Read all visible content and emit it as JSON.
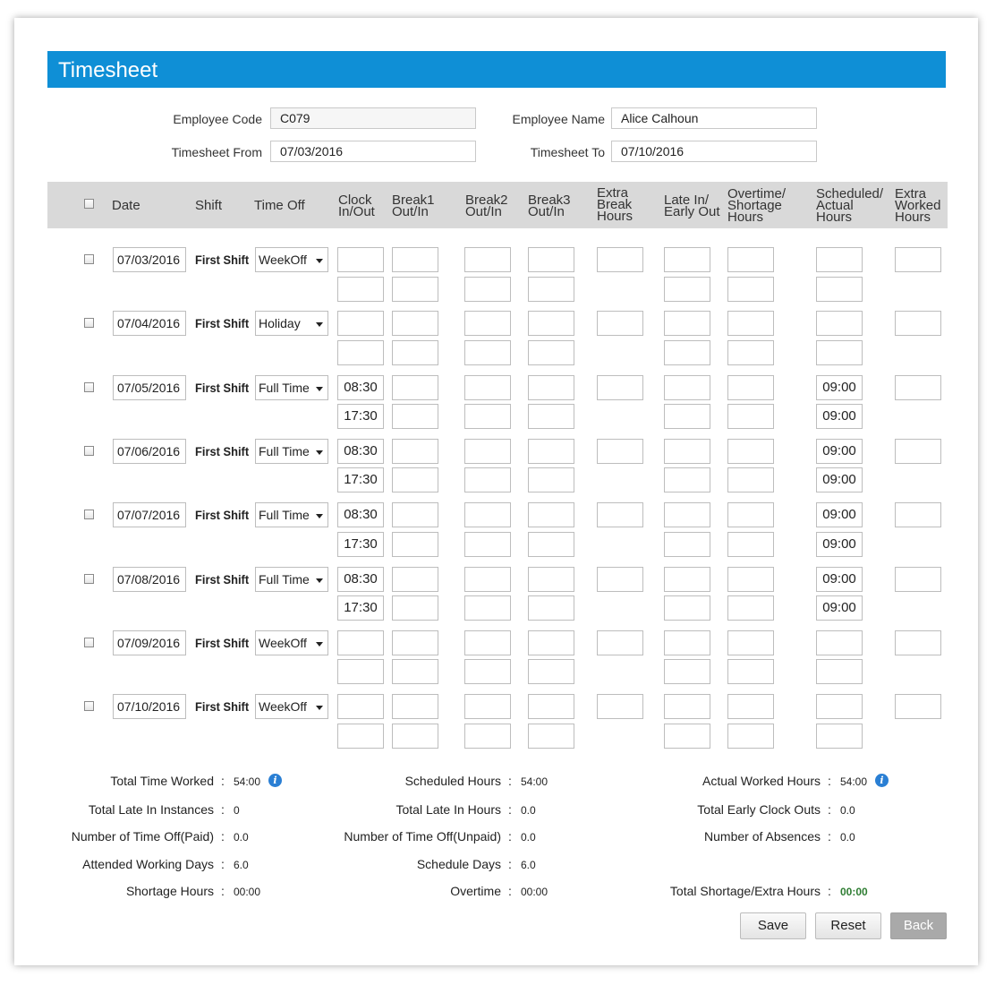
{
  "title": "Timesheet",
  "form": {
    "employee_code_label": "Employee Code",
    "employee_code": "C079",
    "employee_name_label": "Employee Name",
    "employee_name": "Alice Calhoun",
    "from_label": "Timesheet From",
    "from": "07/03/2016",
    "to_label": "Timesheet To",
    "to": "07/10/2016"
  },
  "headers": {
    "date": "Date",
    "shift": "Shift",
    "time_off": "Time Off",
    "clock": [
      "Clock",
      "In/Out"
    ],
    "break1": [
      "Break1",
      "Out/In"
    ],
    "break2": [
      "Break2",
      "Out/In"
    ],
    "break3": [
      "Break3",
      "Out/In"
    ],
    "extra_break": [
      "Extra",
      "Break",
      "Hours"
    ],
    "late": [
      "Late In/",
      "Early Out"
    ],
    "overtime": [
      "Overtime/",
      "Shortage",
      "Hours"
    ],
    "scheduled": [
      "Scheduled/",
      "Actual",
      "Hours"
    ],
    "extra_worked": [
      "Extra",
      "Worked",
      "Hours"
    ]
  },
  "rows": [
    {
      "date": "07/03/2016",
      "shift": "First Shift",
      "time_off": "WeekOff",
      "clock_in": "",
      "clock_out": "",
      "scheduled": "",
      "actual": ""
    },
    {
      "date": "07/04/2016",
      "shift": "First Shift",
      "time_off": "Holiday",
      "clock_in": "",
      "clock_out": "",
      "scheduled": "",
      "actual": ""
    },
    {
      "date": "07/05/2016",
      "shift": "First Shift",
      "time_off": "Full Time",
      "clock_in": "08:30",
      "clock_out": "17:30",
      "scheduled": "09:00",
      "actual": "09:00"
    },
    {
      "date": "07/06/2016",
      "shift": "First Shift",
      "time_off": "Full Time",
      "clock_in": "08:30",
      "clock_out": "17:30",
      "scheduled": "09:00",
      "actual": "09:00"
    },
    {
      "date": "07/07/2016",
      "shift": "First Shift",
      "time_off": "Full Time",
      "clock_in": "08:30",
      "clock_out": "17:30",
      "scheduled": "09:00",
      "actual": "09:00"
    },
    {
      "date": "07/08/2016",
      "shift": "First Shift",
      "time_off": "Full Time",
      "clock_in": "08:30",
      "clock_out": "17:30",
      "scheduled": "09:00",
      "actual": "09:00"
    },
    {
      "date": "07/09/2016",
      "shift": "First Shift",
      "time_off": "WeekOff",
      "clock_in": "",
      "clock_out": "",
      "scheduled": "",
      "actual": ""
    },
    {
      "date": "07/10/2016",
      "shift": "First Shift",
      "time_off": "WeekOff",
      "clock_in": "",
      "clock_out": "",
      "scheduled": "",
      "actual": ""
    }
  ],
  "summary": [
    [
      {
        "label": "Total Time Worked",
        "value": "54:00",
        "info": true
      },
      {
        "label": "Scheduled Hours",
        "value": "54:00"
      },
      {
        "label": "Actual Worked Hours",
        "value": "54:00",
        "info": true
      }
    ],
    [
      {
        "label": "Total Late In Instances",
        "value": "0"
      },
      {
        "label": "Total Late In Hours",
        "value": "0.0"
      },
      {
        "label": "Total Early Clock Outs",
        "value": "0.0"
      }
    ],
    [
      {
        "label": "Number of Time Off(Paid)",
        "value": "0.0"
      },
      {
        "label": "Number of Time Off(Unpaid)",
        "value": "0.0"
      },
      {
        "label": "Number of Absences",
        "value": "0.0"
      }
    ],
    [
      {
        "label": "Attended Working Days",
        "value": "6.0"
      },
      {
        "label": "Schedule Days",
        "value": "6.0"
      },
      null
    ],
    [
      {
        "label": "Shortage Hours",
        "value": "00:00"
      },
      {
        "label": "Overtime",
        "value": "00:00"
      },
      {
        "label": "Total Shortage/Extra Hours",
        "value": "00:00",
        "accent": "#2e7d32"
      }
    ]
  ],
  "buttons": {
    "save": "Save",
    "reset": "Reset",
    "back": "Back"
  },
  "colors": {
    "header_bar": "#0f8fd6",
    "table_header": "#d9d9d9",
    "accent_value": "#2e7d32"
  }
}
